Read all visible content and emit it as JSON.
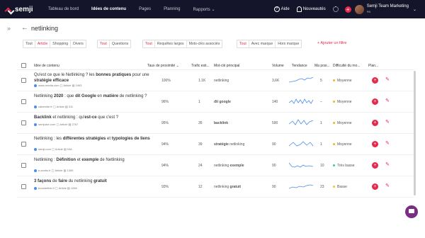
{
  "app": {
    "brand": "semji"
  },
  "topbar": {
    "nav": [
      "Tableau de bord",
      "Idées de contenu",
      "Pages",
      "Planning",
      "Rapports ⌄"
    ],
    "help": "Aide",
    "news": "Nouveautés",
    "user_name": "Semji Team Marketing",
    "user_role": "PB"
  },
  "header": {
    "keyword": "netlinking",
    "collapse_icon": "double-chevron-right-icon",
    "back_icon": "arrow-left-icon"
  },
  "filters": {
    "type": [
      "Tout",
      "Article",
      "Shopping",
      "Divers"
    ],
    "intent": [
      "Tout",
      "Questions"
    ],
    "scope": [
      "Tout",
      "Requêtes larges",
      "Mots-clés associés"
    ],
    "brand": [
      "Tout",
      "Avec marque",
      "Hors marque"
    ],
    "add_filter": "+ Ajouter un filtre"
  },
  "table": {
    "columns": [
      "Idée de contenu",
      "Taux de proximité ⌄",
      "Trafic esti...",
      "Mot-clé principal",
      "Volume",
      "Tendance",
      "Ma posi...",
      "Difficulté du mo...",
      "Plan..."
    ],
    "rows": [
      {
        "title_html": "Qu'est ce que le Netlinking ? les <b>bonnes pratiques</b> pour une <b>stratégie efficace</b>",
        "site": "www-media.com",
        "type": "Article",
        "words": "1993",
        "proximity": "100%",
        "traffic": "1.1K",
        "keyword": "netlinking",
        "volume": "3,6K",
        "position": "5",
        "difficulty": "Moyenne",
        "diff_color": "#f0b429"
      },
      {
        "title_html": "Netlinking <b>2020</b> : que <b>dit Google</b> en <b>matière</b> de netlinking ?",
        "site": "cabemite.fr",
        "type": "Article",
        "words": "311",
        "proximity": "96%",
        "traffic": "1",
        "keyword": "dit google",
        "keyword_bold": true,
        "volume": "140",
        "position": "–",
        "difficulty": "Moyenne",
        "diff_color": "#f0b429"
      },
      {
        "title_html": "<b>Backlink</b> et netlinking : qu'<b>est-ce</b> que c'est ?",
        "site": "semjuice.com",
        "type": "Article",
        "words": "2767",
        "proximity": "95%",
        "traffic": "35",
        "keyword": "backlink",
        "keyword_bold": true,
        "volume": "590",
        "position": "1",
        "difficulty": "Moyenne",
        "diff_color": "#f0b429"
      },
      {
        "title_html": "Netlinking : les <b>différentes stratégies</b> et <b>typologies de liens</b>",
        "site": "semji.com",
        "type": "Article",
        "words": "N/A",
        "proximity": "94%",
        "traffic": "39",
        "keyword": "<b>stratégie</b> netlinking",
        "volume": "90",
        "position": "1",
        "difficulty": "Moyenne",
        "diff_color": "#f0b429"
      },
      {
        "title_html": "Netlinking : <b>Définition</b> et <b>exemple</b> de Netlinking",
        "site": "e-works.fr",
        "type": "Article",
        "words": "1309",
        "proximity": "94%",
        "traffic": "24",
        "keyword": "netlinking <b>exemple</b>",
        "volume": "90",
        "position": "10",
        "difficulty": "Très basse",
        "diff_color": "#3cc88a"
      },
      {
        "title_html": "<b>3 façons</b> de <b>faire</b> du netlinking <b>gratuit</b>",
        "site": "boosterlink.fr",
        "type": "Article",
        "words": "1266",
        "proximity": "93%",
        "traffic": "12",
        "keyword": "netlinking <b>gratuit</b>",
        "volume": "90",
        "position": "23",
        "difficulty": "Basse",
        "diff_color": "#e8c830"
      }
    ]
  },
  "colors": {
    "accent": "#e6284b",
    "topbar": "#14142a",
    "sparkline": "#4a8de8"
  }
}
